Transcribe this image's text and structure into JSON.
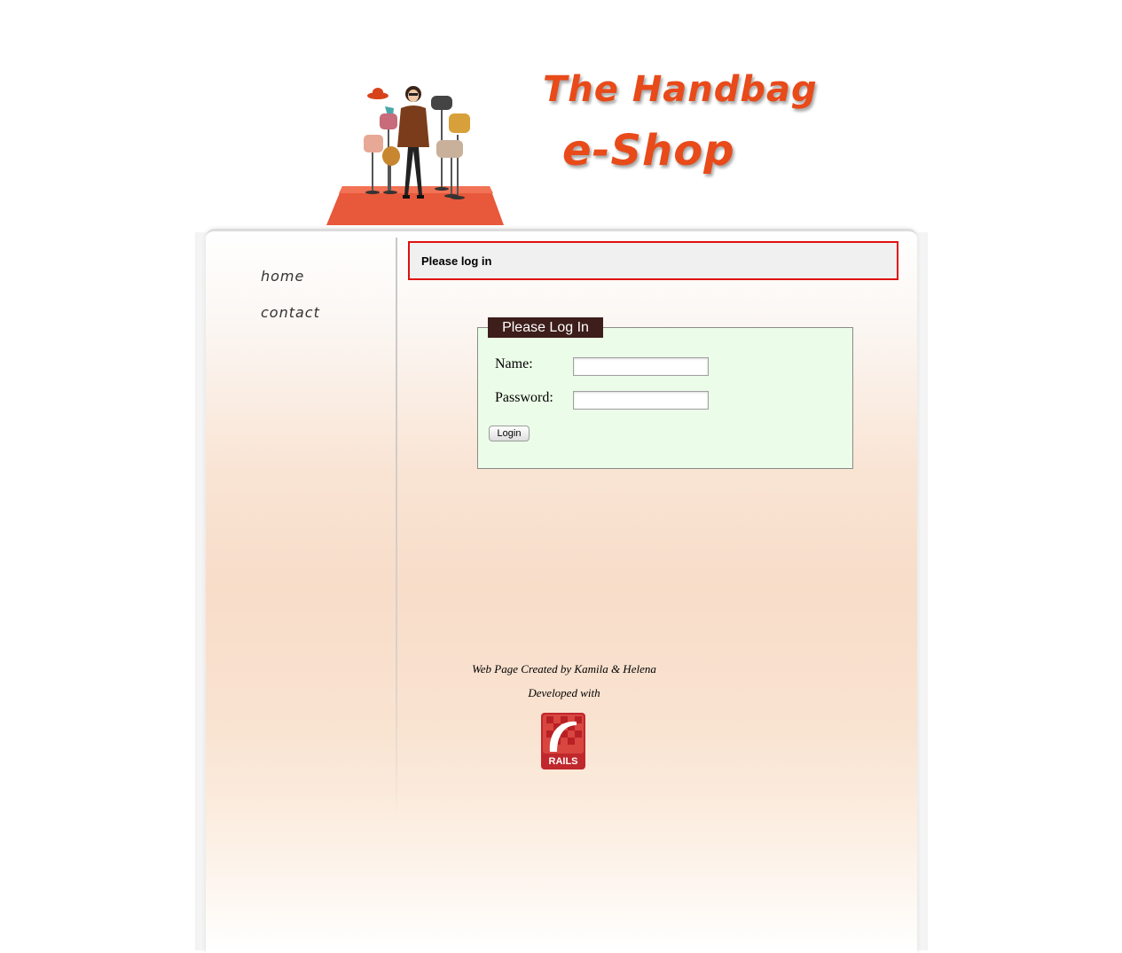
{
  "header": {
    "title_line_1": "The Handbag",
    "title_line_2": "e-Shop"
  },
  "sidebar": {
    "items": [
      {
        "label": "home"
      },
      {
        "label": "contact"
      }
    ]
  },
  "notice": {
    "text": "Please log in"
  },
  "login_form": {
    "legend": "Please Log In",
    "name_label": "Name:",
    "name_value": "",
    "password_label": "Password:",
    "password_value": "",
    "submit_label": "Login"
  },
  "footer": {
    "credit": "Web Page Created by Kamila & Helena",
    "developed_with": "Developed with",
    "logo_text": "RAILS"
  },
  "colors": {
    "title": "#e84a1a",
    "notice_border": "#e01010",
    "legend_bg": "#3d1e1a",
    "form_bg": "#ebfde8",
    "rails_red": "#c0282d"
  }
}
